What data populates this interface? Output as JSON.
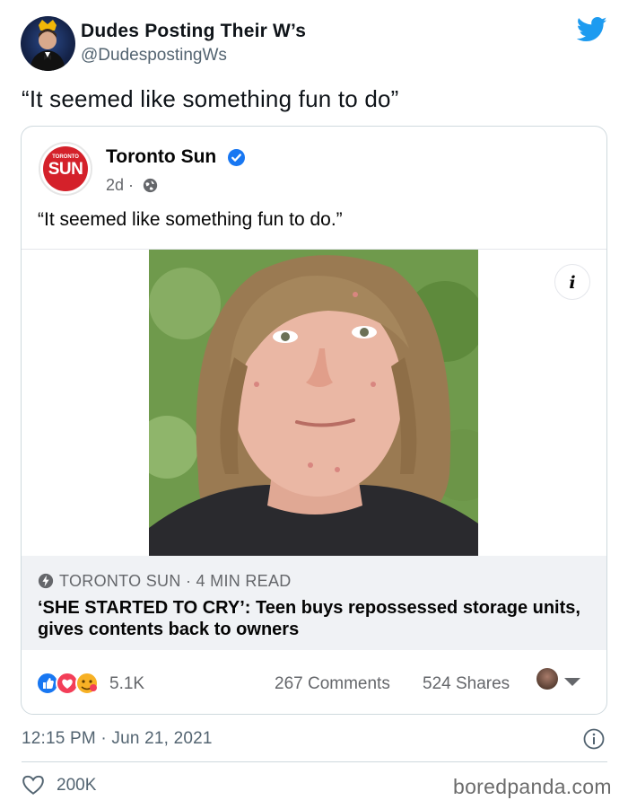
{
  "tweet": {
    "display_name": "Dudes Posting Their W’s",
    "handle": "@DudespostingWs",
    "text": "“It seemed like something fun to do”",
    "timestamp": "12:15 PM · Jun 21, 2021",
    "like_count": "200K"
  },
  "embedded_post": {
    "page_name": "Toronto Sun",
    "logo_small": "TORONTO",
    "logo_word": "SUN",
    "time": "2d ·",
    "text": "“It seemed like something fun to do.”",
    "link_source": "TORONTO SUN · 4 MIN READ",
    "link_headline": "‘SHE STARTED TO CRY’: Teen buys repossessed storage units, gives contents back to owners",
    "reaction_count": "5.1K",
    "comments": "267 Comments",
    "shares": "524 Shares"
  },
  "watermark": "boredpanda.com",
  "colors": {
    "twitter_blue": "#1d9bf0",
    "fb_blue": "#1877f2",
    "sun_red": "#d4212a"
  }
}
